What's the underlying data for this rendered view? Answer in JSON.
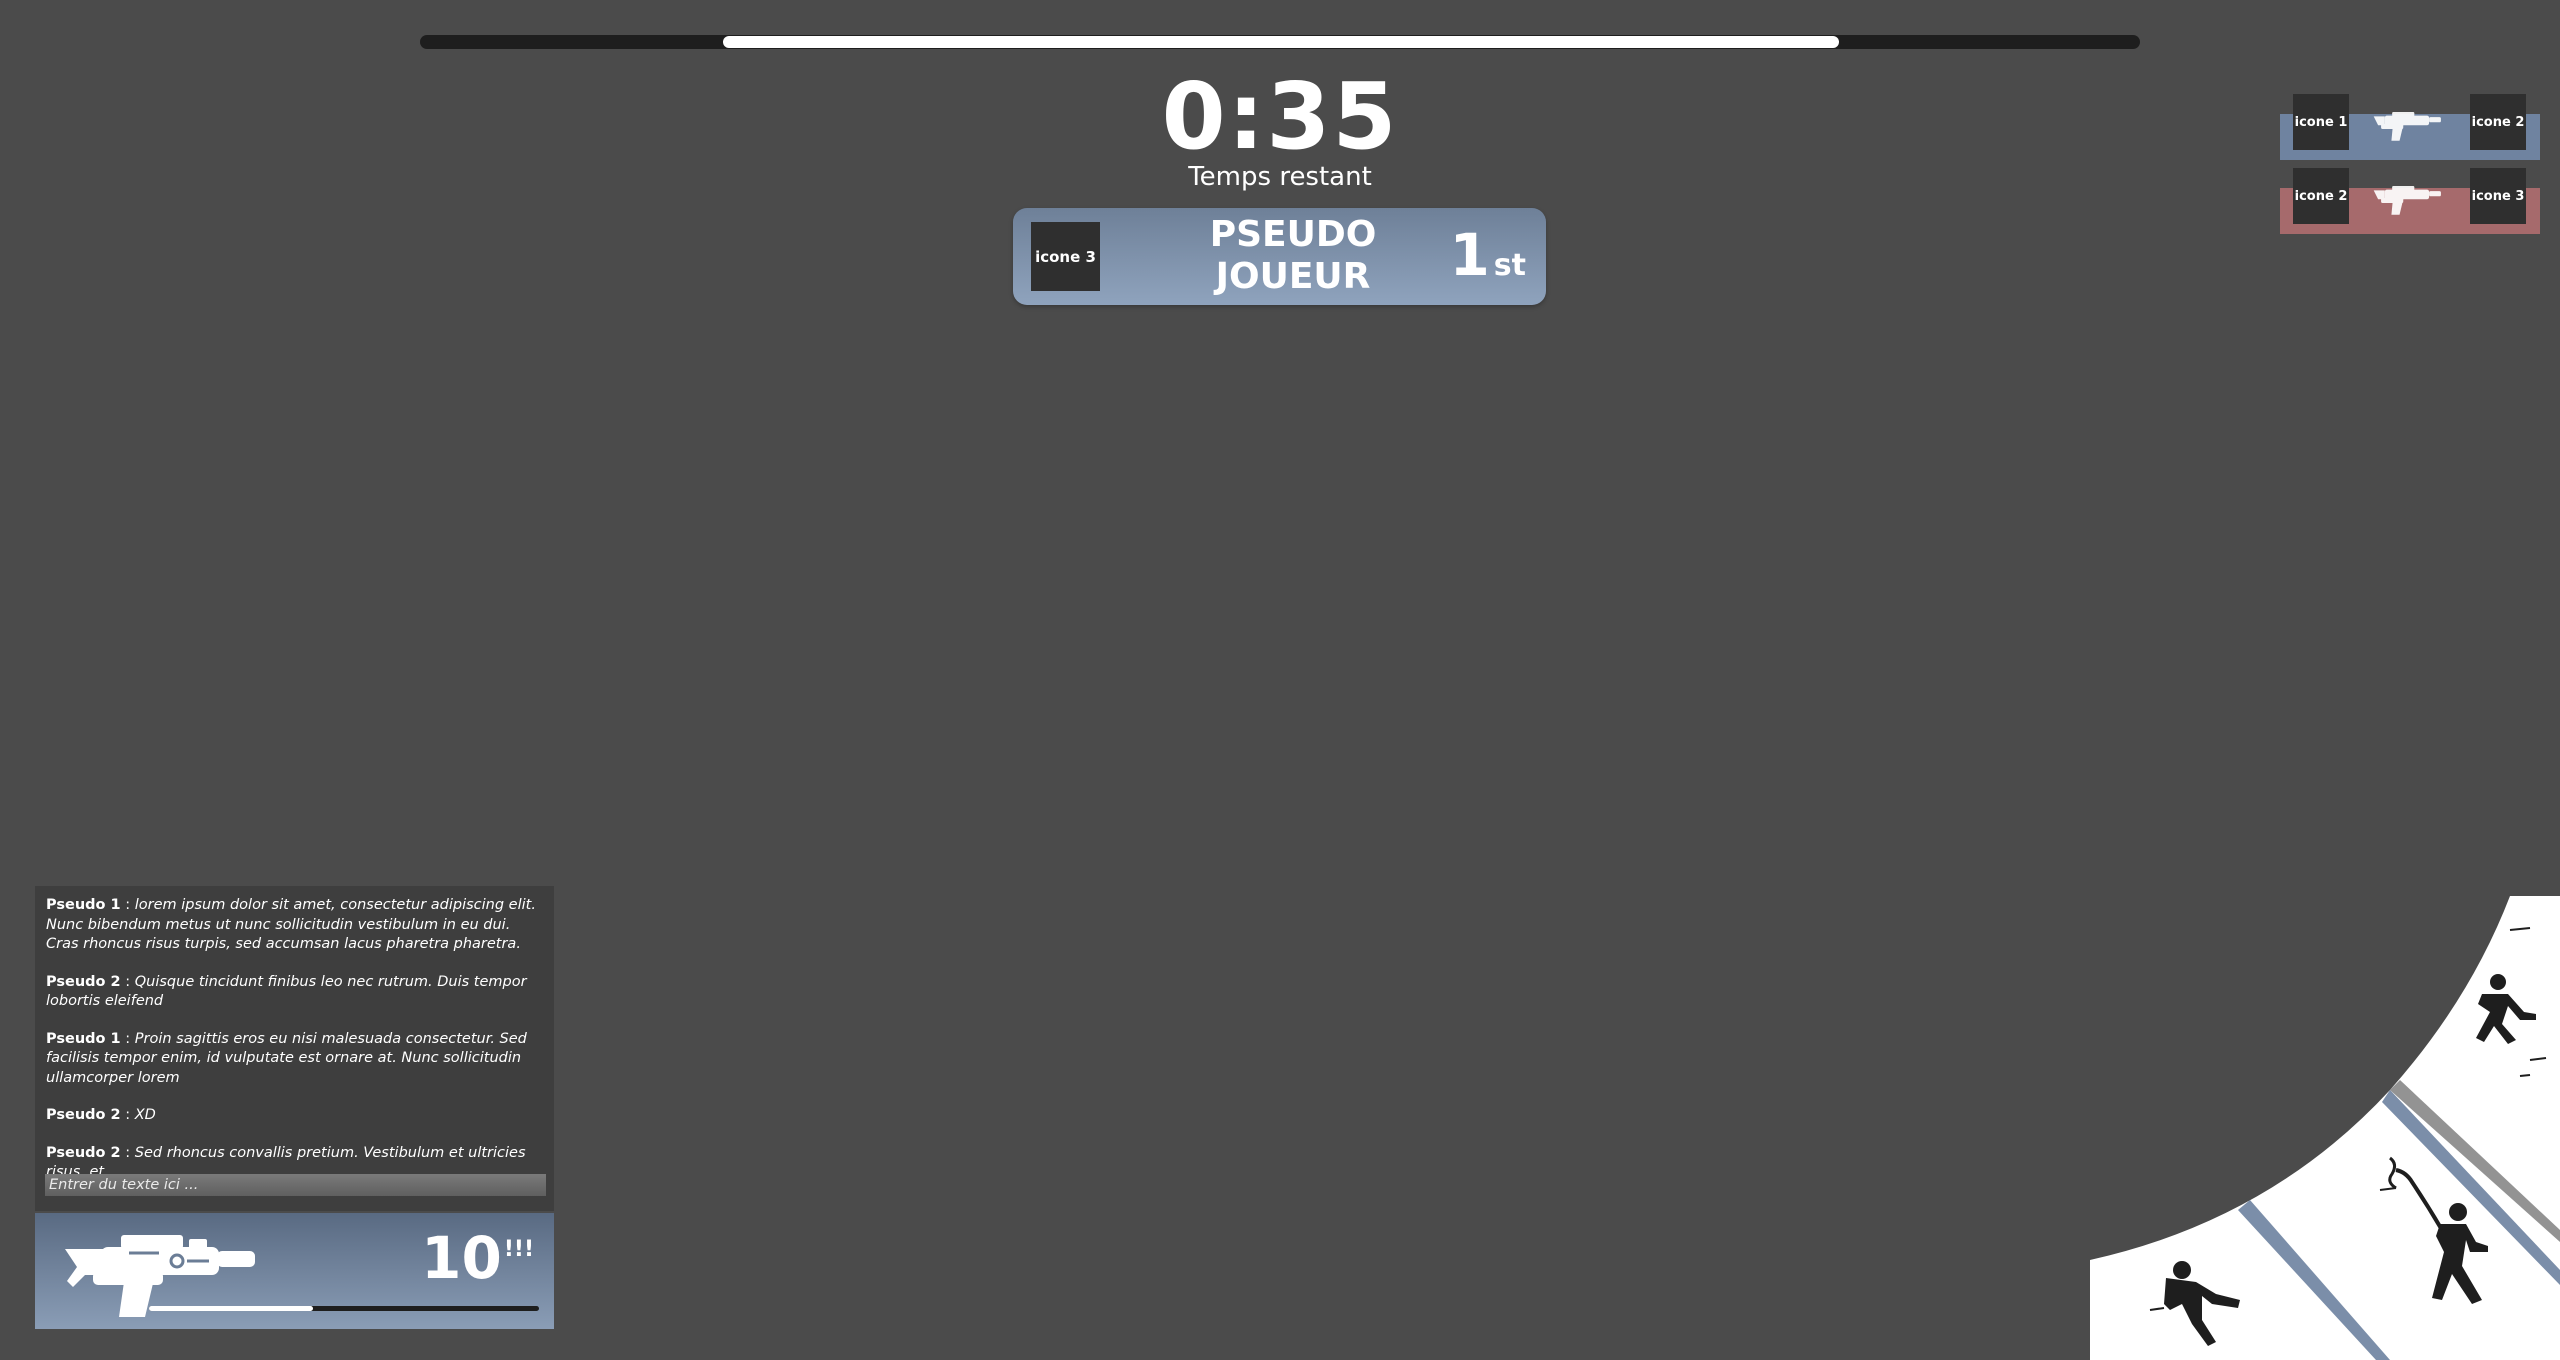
{
  "top_progress": {
    "fill_start": 0.176,
    "fill_end": 0.825
  },
  "timer": {
    "value": "0:35",
    "label": "Temps restant"
  },
  "player": {
    "icon": "icone 3",
    "name_line1": "PSEUDO",
    "name_line2": "JOUEUR",
    "rank_number": "1",
    "rank_suffix": "st"
  },
  "killfeed": [
    {
      "team": "blue",
      "left_icon": "icone 1",
      "weapon": "blaster-icon",
      "right_icon": "icone 2"
    },
    {
      "team": "red",
      "left_icon": "icone 2",
      "weapon": "blaster-icon",
      "right_icon": "icone 3"
    }
  ],
  "chat": {
    "messages": [
      {
        "author": "Pseudo 1",
        "sep": " : ",
        "text": "lorem ipsum dolor sit amet, consectetur adipiscing elit. Nunc bibendum metus ut nunc sollicitudin vestibulum in eu dui. Cras rhoncus risus turpis, sed accumsan lacus pharetra pharetra."
      },
      {
        "author": "Pseudo 2",
        "sep": " : ",
        "text": "Quisque tincidunt finibus leo nec rutrum. Duis tempor lobortis eleifend"
      },
      {
        "author": "Pseudo 1",
        "sep": " : ",
        "text": "Proin sagittis eros eu nisi malesuada consectetur. Sed facilisis tempor enim, id vulputate est ornare at. Nunc sollicitudin ullamcorper lorem"
      },
      {
        "author": "Pseudo 2",
        "sep": " : ",
        "text": "XD"
      },
      {
        "author": "Pseudo 2",
        "sep": " : ",
        "text": "Sed rhoncus convallis pretium. Vestibulum et ultricies risus, et"
      }
    ],
    "input_placeholder": "Entrer du texte ici ..."
  },
  "weapon": {
    "icon": "blaster-icon",
    "ammo_count": "10",
    "ammo_marker": "!!!",
    "reload_progress": 0.42
  },
  "colors": {
    "background": "#4b4b4b",
    "blue_team": "#6f83a0",
    "red_team": "#a66a6c",
    "icon_box": "#2f2f2f"
  }
}
